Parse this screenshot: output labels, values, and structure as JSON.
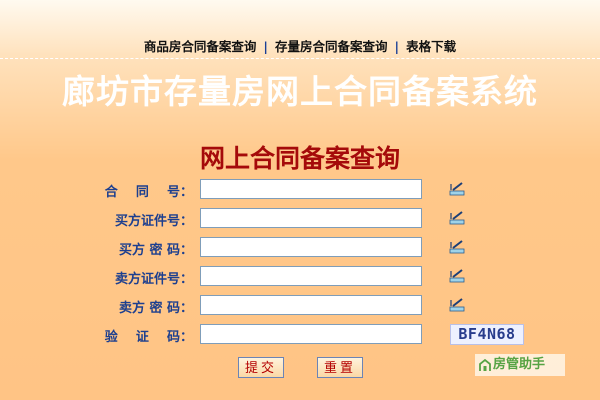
{
  "nav": {
    "links": [
      "商品房合同备案查询",
      "存量房合同备案查询",
      "表格下载"
    ],
    "separator": "|"
  },
  "header": {
    "title": "廊坊市存量房网上合同备案系统"
  },
  "form": {
    "title": "网上合同备案查询",
    "fields": [
      {
        "label": "合    同    号：",
        "value": ""
      },
      {
        "label": "买方证件号：",
        "value": ""
      },
      {
        "label": "买方 密 码：",
        "value": ""
      },
      {
        "label": "卖方证件号：",
        "value": ""
      },
      {
        "label": "卖方 密 码：",
        "value": ""
      },
      {
        "label": "验    证    码：",
        "value": ""
      }
    ],
    "captcha_text": "BF4N68",
    "submit_label": "提交",
    "reset_label": "重置"
  },
  "watermark": {
    "text": "房管助手"
  },
  "colors": {
    "title_white": "#ffffff",
    "form_title_red": "#a50a0a",
    "label_blue": "#1d3f8f",
    "button_text": "#b40000",
    "watermark_green": "#57a343"
  },
  "icons": {
    "field_assist": "pencil-keyboard-icon",
    "watermark_logo": "house-icon"
  }
}
